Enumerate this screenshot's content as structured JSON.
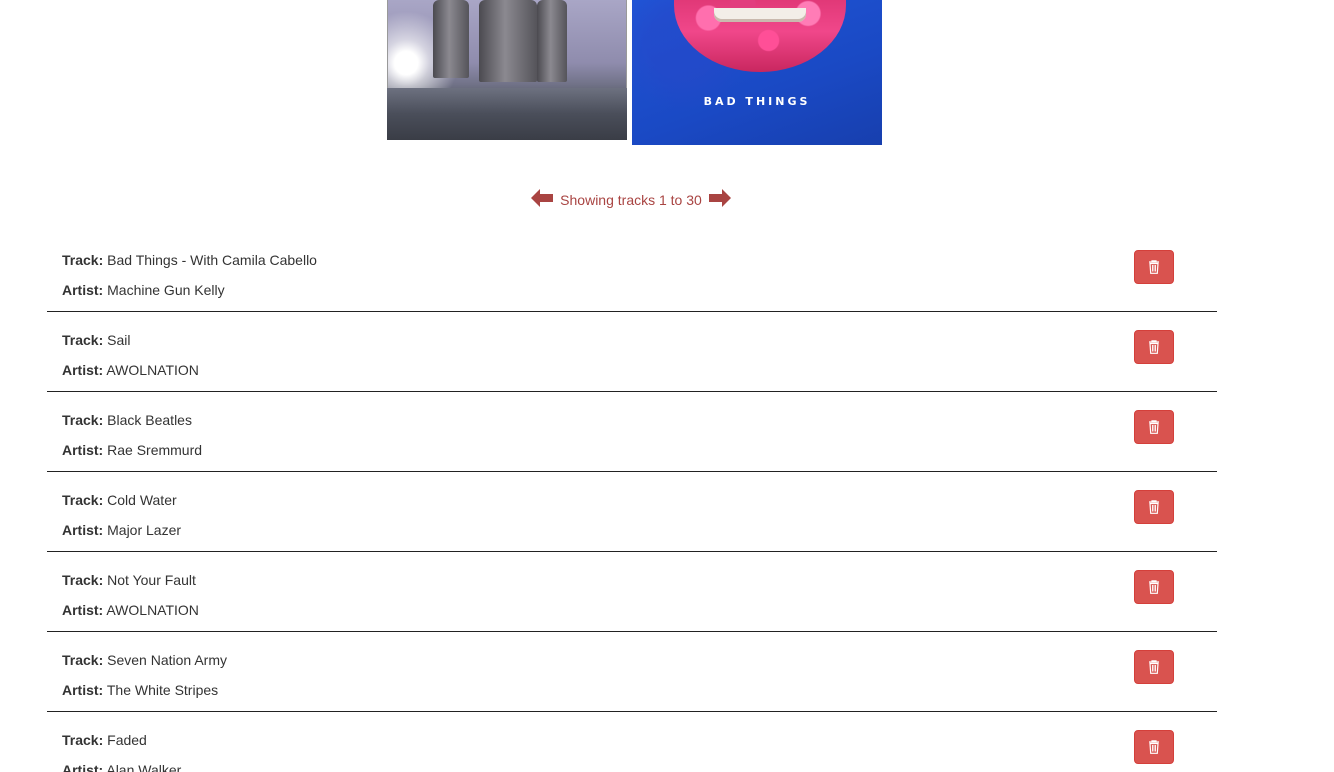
{
  "album_art": {
    "left_name": "album-cover-skyline",
    "right_title": "BAD THINGS"
  },
  "pagination": {
    "label": "Showing tracks 1 to 30",
    "prev_icon": "arrow-left-icon",
    "next_icon": "arrow-right-icon",
    "color": "#a94442"
  },
  "labels": {
    "track": "Track:",
    "artist": "Artist:"
  },
  "delete_icon": "trash-icon",
  "delete_color": "#d9534f",
  "tracks": [
    {
      "track": "Bad Things - With Camila Cabello",
      "artist": "Machine Gun Kelly"
    },
    {
      "track": "Sail",
      "artist": "AWOLNATION"
    },
    {
      "track": "Black Beatles",
      "artist": "Rae Sremmurd"
    },
    {
      "track": "Cold Water",
      "artist": "Major Lazer"
    },
    {
      "track": "Not Your Fault",
      "artist": "AWOLNATION"
    },
    {
      "track": "Seven Nation Army",
      "artist": "The White Stripes"
    },
    {
      "track": "Faded",
      "artist": "Alan Walker"
    }
  ]
}
